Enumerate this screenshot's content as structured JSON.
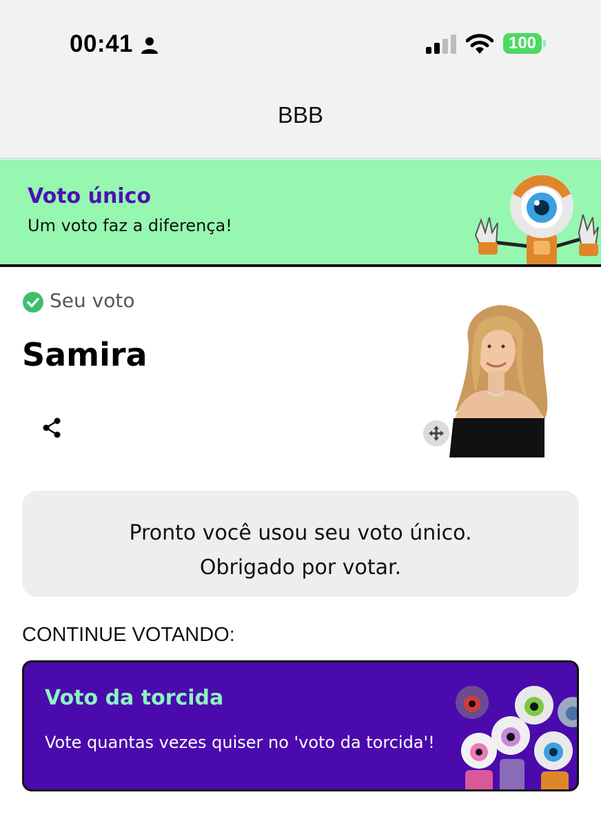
{
  "status_bar": {
    "time": "00:41",
    "battery": "100",
    "icons": [
      "person-icon",
      "signal-icon",
      "wifi-icon",
      "battery-icon"
    ]
  },
  "header": {
    "title": "BBB"
  },
  "banner": {
    "title": "Voto único",
    "subtitle": "Um voto faz a diferença!",
    "background": "#96f7b0",
    "title_color": "#4b12b0"
  },
  "vote": {
    "label": "Seu voto",
    "candidate": "Samira",
    "check_color": "#3fbf6c"
  },
  "message": {
    "line1": "Pronto você usou seu voto único.",
    "line2": "Obrigado por votar."
  },
  "continue": {
    "heading": "CONTINUE VOTANDO:",
    "card_title": "Voto da torcida",
    "card_subtitle": "Vote quantas vezes quiser no 'voto da torcida'!",
    "card_background": "#4b0aad",
    "card_title_color": "#8cf5c0"
  }
}
